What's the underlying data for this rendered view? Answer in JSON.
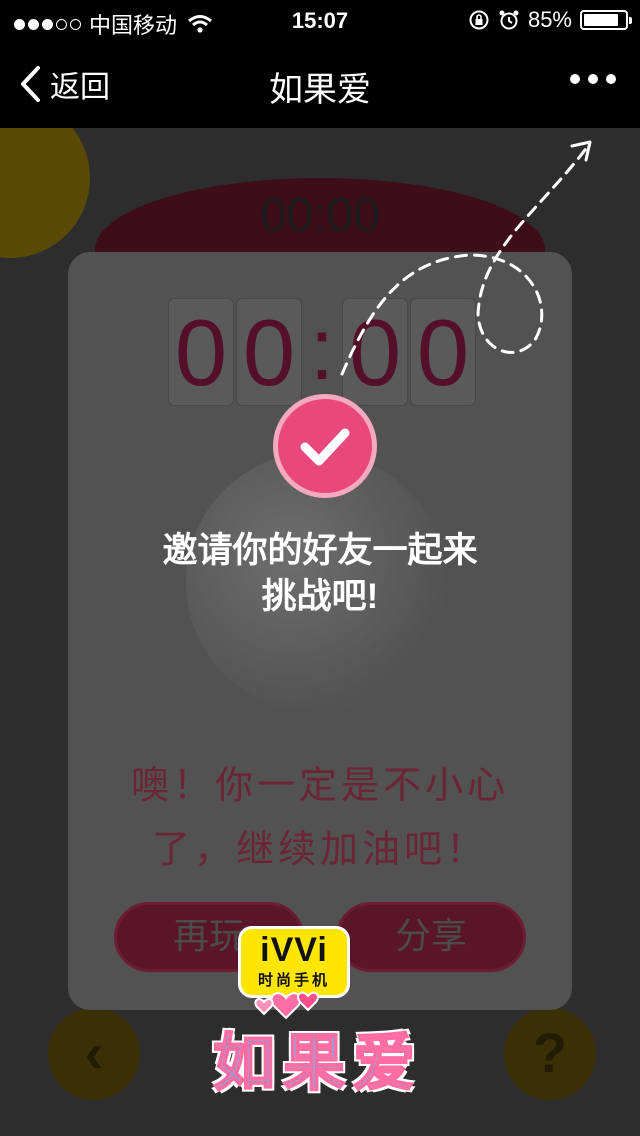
{
  "status_bar": {
    "carrier": "中国移动",
    "time": "15:07",
    "battery_text": "85%",
    "battery_level": 0.85,
    "signal_bars_filled": 3,
    "signal_bars_total": 5
  },
  "nav": {
    "back_label": "返回",
    "title": "如果爱"
  },
  "game": {
    "timer": "00:00",
    "buttons": {
      "left_icon": "chevron-left-icon",
      "right_icon": "question-icon"
    }
  },
  "dialog": {
    "digits": [
      "0",
      "0",
      "0",
      "0"
    ],
    "colon": ":",
    "invite_line1": "邀请你的好友一起来",
    "invite_line2": "挑战吧!",
    "message_line1": "噢！你一定是不小心",
    "message_line2": "了，继续加油吧！",
    "replay_label": "再玩",
    "share_label": "分享"
  },
  "logo": {
    "ivvi": "iVVi",
    "tagline": "时尚手机",
    "brand": "如果爱"
  },
  "colors": {
    "accent_pink": "#e8497a",
    "badge_yellow": "#ffe600",
    "overlay": "#525252"
  }
}
